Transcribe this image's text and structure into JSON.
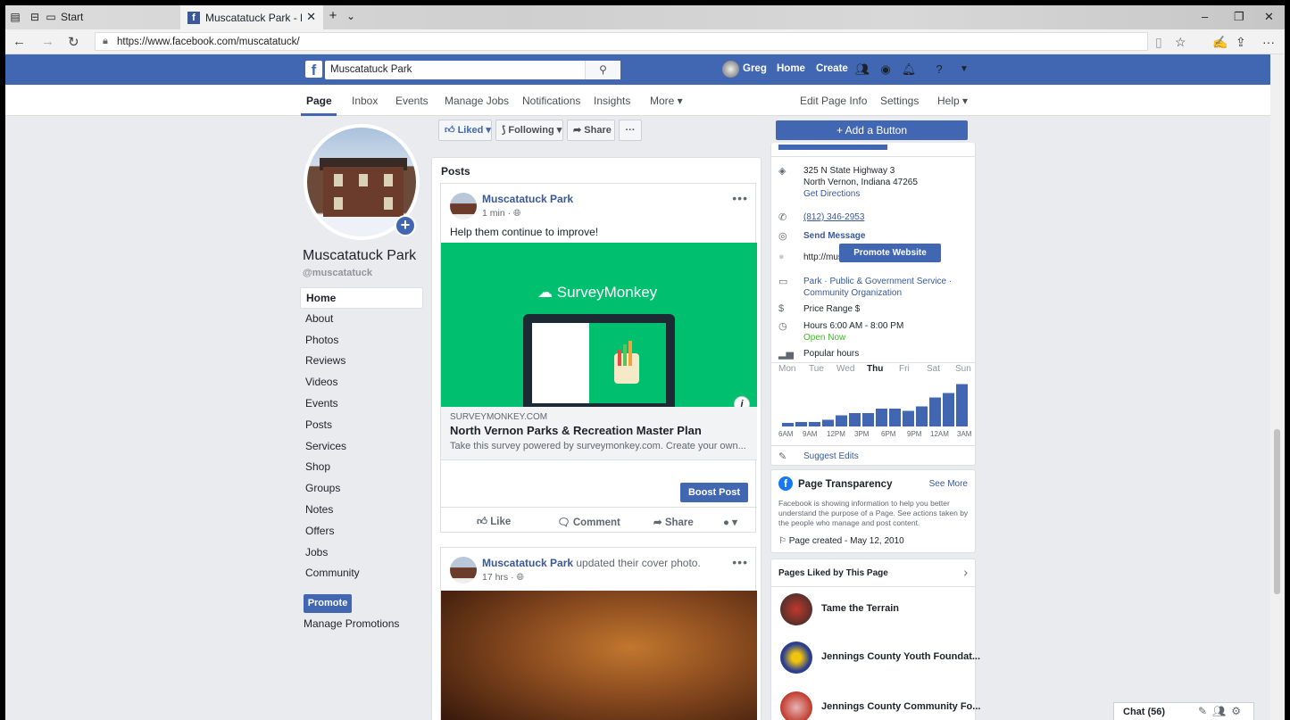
{
  "browser": {
    "tab_start": "Start",
    "tab_title": "Muscatatuck Park - Hon",
    "url": "https://www.facebook.com/muscatatuck/"
  },
  "fb_header": {
    "search_value": "Muscatatuck Park",
    "user": "Greg",
    "home": "Home",
    "create": "Create"
  },
  "subnav": {
    "left": [
      "Page",
      "Inbox",
      "Events",
      "Manage Jobs",
      "Notifications",
      "Insights",
      "More ▾"
    ],
    "right": [
      "Edit Page Info",
      "Settings",
      "Help ▾"
    ]
  },
  "page": {
    "name": "Muscatatuck Park",
    "handle": "@muscatatuck"
  },
  "left_nav": [
    "Home",
    "About",
    "Photos",
    "Reviews",
    "Videos",
    "Events",
    "Posts",
    "Services",
    "Shop",
    "Groups",
    "Notes",
    "Offers",
    "Jobs",
    "Community"
  ],
  "promote": "Promote",
  "manage_promotions": "Manage Promotions",
  "action_bar": {
    "liked": "Liked ▾",
    "following": "Following ▾",
    "share": "Share",
    "more": "···"
  },
  "posts": {
    "title": "Posts",
    "post1": {
      "author": "Muscatatuck Park",
      "time": "1 min · ",
      "text": "Help them continue to improve!",
      "brand": "SurveyMonkey",
      "link_domain": "SURVEYMONKEY.COM",
      "link_title": "North Vernon Parks & Recreation Master Plan",
      "link_desc": "Take this survey powered by surveymonkey.com. Create your own...",
      "boost": "Boost Post",
      "like": "Like",
      "comment": "Comment",
      "share": "Share"
    },
    "post2": {
      "author": "Muscatatuck Park",
      "action": " updated their cover photo.",
      "time": "17 hrs · "
    }
  },
  "about": {
    "add_button": "+ Add a Button",
    "address1": "325 N State Highway 3",
    "address2": "North Vernon, Indiana 47265",
    "directions": "Get Directions",
    "phone": "(812) 346-2953",
    "send_message": "Send Message",
    "website": "http://muscatatuckpa...",
    "promote_website": "Promote Website",
    "category1": "Park · Public & Government Service ·",
    "category2": "Community Organization",
    "price": "Price Range $",
    "hours": "Hours 6:00 AM - 8:00 PM",
    "open_now": "Open Now",
    "popular_hours": "Popular hours",
    "days": [
      "Mon",
      "Tue",
      "Wed",
      "Thu",
      "Fri",
      "Sat",
      "Sun"
    ],
    "current_day": "Thu",
    "hour_labels": [
      "6AM",
      "9AM",
      "12PM",
      "3PM",
      "6PM",
      "9PM",
      "12AM",
      "3AM"
    ],
    "popularity": [
      0.08,
      0.1,
      0.1,
      0.15,
      0.25,
      0.3,
      0.3,
      0.4,
      0.4,
      0.35,
      0.45,
      0.65,
      0.75,
      0.95
    ],
    "suggest_edits": "Suggest Edits"
  },
  "transparency": {
    "title": "Page Transparency",
    "see_more": "See More",
    "desc1": "Facebook is showing information to help you better",
    "desc2": "understand the purpose of a Page. See actions taken by",
    "desc3": "the people who manage and post content.",
    "created": "Page created - May 12, 2010"
  },
  "pages_liked": {
    "title": "Pages Liked by This Page",
    "items": [
      "Tame the Terrain",
      "Jennings County Youth Foundat...",
      "Jennings County Community Fo..."
    ]
  },
  "chat": {
    "label": "Chat (56)"
  },
  "colors": {
    "fb_blue": "#4267b2",
    "link": "#385898",
    "survey_green": "#00bf6f"
  }
}
